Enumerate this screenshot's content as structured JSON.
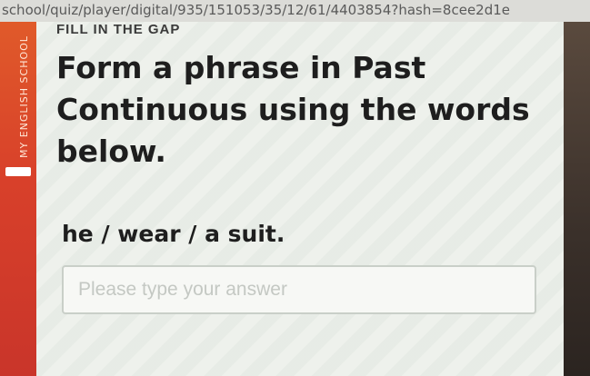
{
  "browser": {
    "url": "school/quiz/player/digital/935/151053/35/12/61/4403854?hash=8cee2d1e"
  },
  "sidebar": {
    "brand_text": "MY ENGLISH SCHOOL"
  },
  "quiz": {
    "section_title": "FILL IN THE GAP",
    "question_line1": "Form a phrase in Past",
    "question_line2": "Continuous using the words",
    "question_line3": "below.",
    "prompt": "he / wear / a suit.",
    "answer_value": "",
    "answer_placeholder": "Please type your answer"
  },
  "colors": {
    "brand_orange": "#d8402a",
    "text_dark": "#1e1e1e",
    "card_bg": "#eef1ec"
  }
}
